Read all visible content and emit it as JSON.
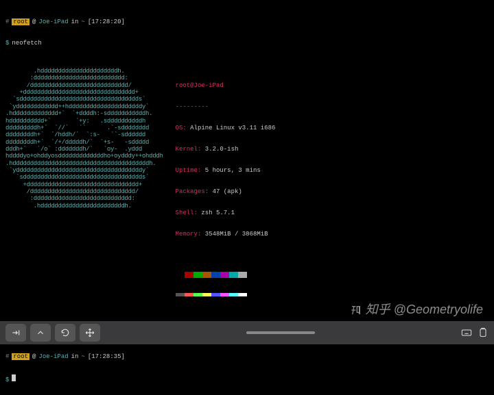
{
  "prompt1": {
    "hash": "#",
    "user": "root",
    "at": "@",
    "host": "Joe-iPad",
    "in": "in",
    "dir": "~",
    "time": "[17:28:20]",
    "dollar": "$",
    "cmd": "neofetch"
  },
  "ascii": [
    "        .hddddddddddddddddddddddh.         ",
    "       :dddddddddddddddddddddddddd:        ",
    "      /dddddddddddddddddddddddddddd/       ",
    "    +dddddddddddddddddddddddddddddddd+     ",
    "  `sdddddddddddddddddddddddddddddddddds`   ",
    " `ydddddddddddd++hdddddddddddddddddddddy`  ",
    ".hddddddddddddd+`  `+ddddh:-sdddddddddddh. ",
    "hdddddddddd+`       `+y:   .sddddddddddh   ",
    "dddddddddh+`  `//`   ``      .`-sdddddddd  ",
    "ddddddddh+`  `/hddh/`  `:s-   ``-sdddddd   ",
    "ddddddddh+`  `/+/dddddh/`  `+s-   -sddddd  ",
    "dddh+`   `/o` :dddddddh/`   `oy-  .yddd    ",
    "hddddyo+ohddyosdddddddddddddho+oydddy++ohdddh",
    ".hdddddddddddddddddddddddddddddddddddddddh.",
    " `yddddddddddddddddddddddddddddddddddddy`  ",
    "   `sdddddddddddddddddddddddddddddddddds`  ",
    "     +dddddddddddddddddddddddddddddddd+    ",
    "      /dddddddddddddddddddddddddddddd/     ",
    "       :dddddddddddddddddddddddddddd:      ",
    "        .hddddddddddddddddddddddddh.       "
  ],
  "info": {
    "userhost": "root@Joe-iPad",
    "sep": "---------",
    "os_label": "OS:",
    "os": "Alpine Linux v3.11 i686",
    "kernel_label": "Kernel:",
    "kernel": "3.2.0-ish",
    "uptime_label": "Uptime:",
    "uptime": "5 hours, 3 mins",
    "packages_label": "Packages:",
    "packages": "47 (apk)",
    "shell_label": "Shell:",
    "shell": "zsh 5.7.1",
    "memory_label": "Memory:",
    "memory": "3548MiB / 3868MiB"
  },
  "palette1": [
    "#000000",
    "#aa0000",
    "#00aa00",
    "#aa5500",
    "#0044aa",
    "#aa00aa",
    "#00aaaa",
    "#aaaaaa"
  ],
  "palette2": [
    "#555555",
    "#ff5555",
    "#55ff55",
    "#ffff55",
    "#5555ff",
    "#ff55ff",
    "#55ffff",
    "#ffffff"
  ],
  "prompt2": {
    "hash": "#",
    "user": "root",
    "at": "@",
    "host": "Joe-iPad",
    "in": "in",
    "dir": "~",
    "time": "[17:28:35]",
    "dollar": "$"
  },
  "watermark": "知乎 @Geometryolife",
  "toolbar": {
    "tab": "tab-key-icon",
    "up": "chevron-up-icon",
    "reload": "reload-icon",
    "move": "move-icon",
    "keyboard": "keyboard-icon",
    "paste": "clipboard-icon"
  },
  "chart_data": null
}
